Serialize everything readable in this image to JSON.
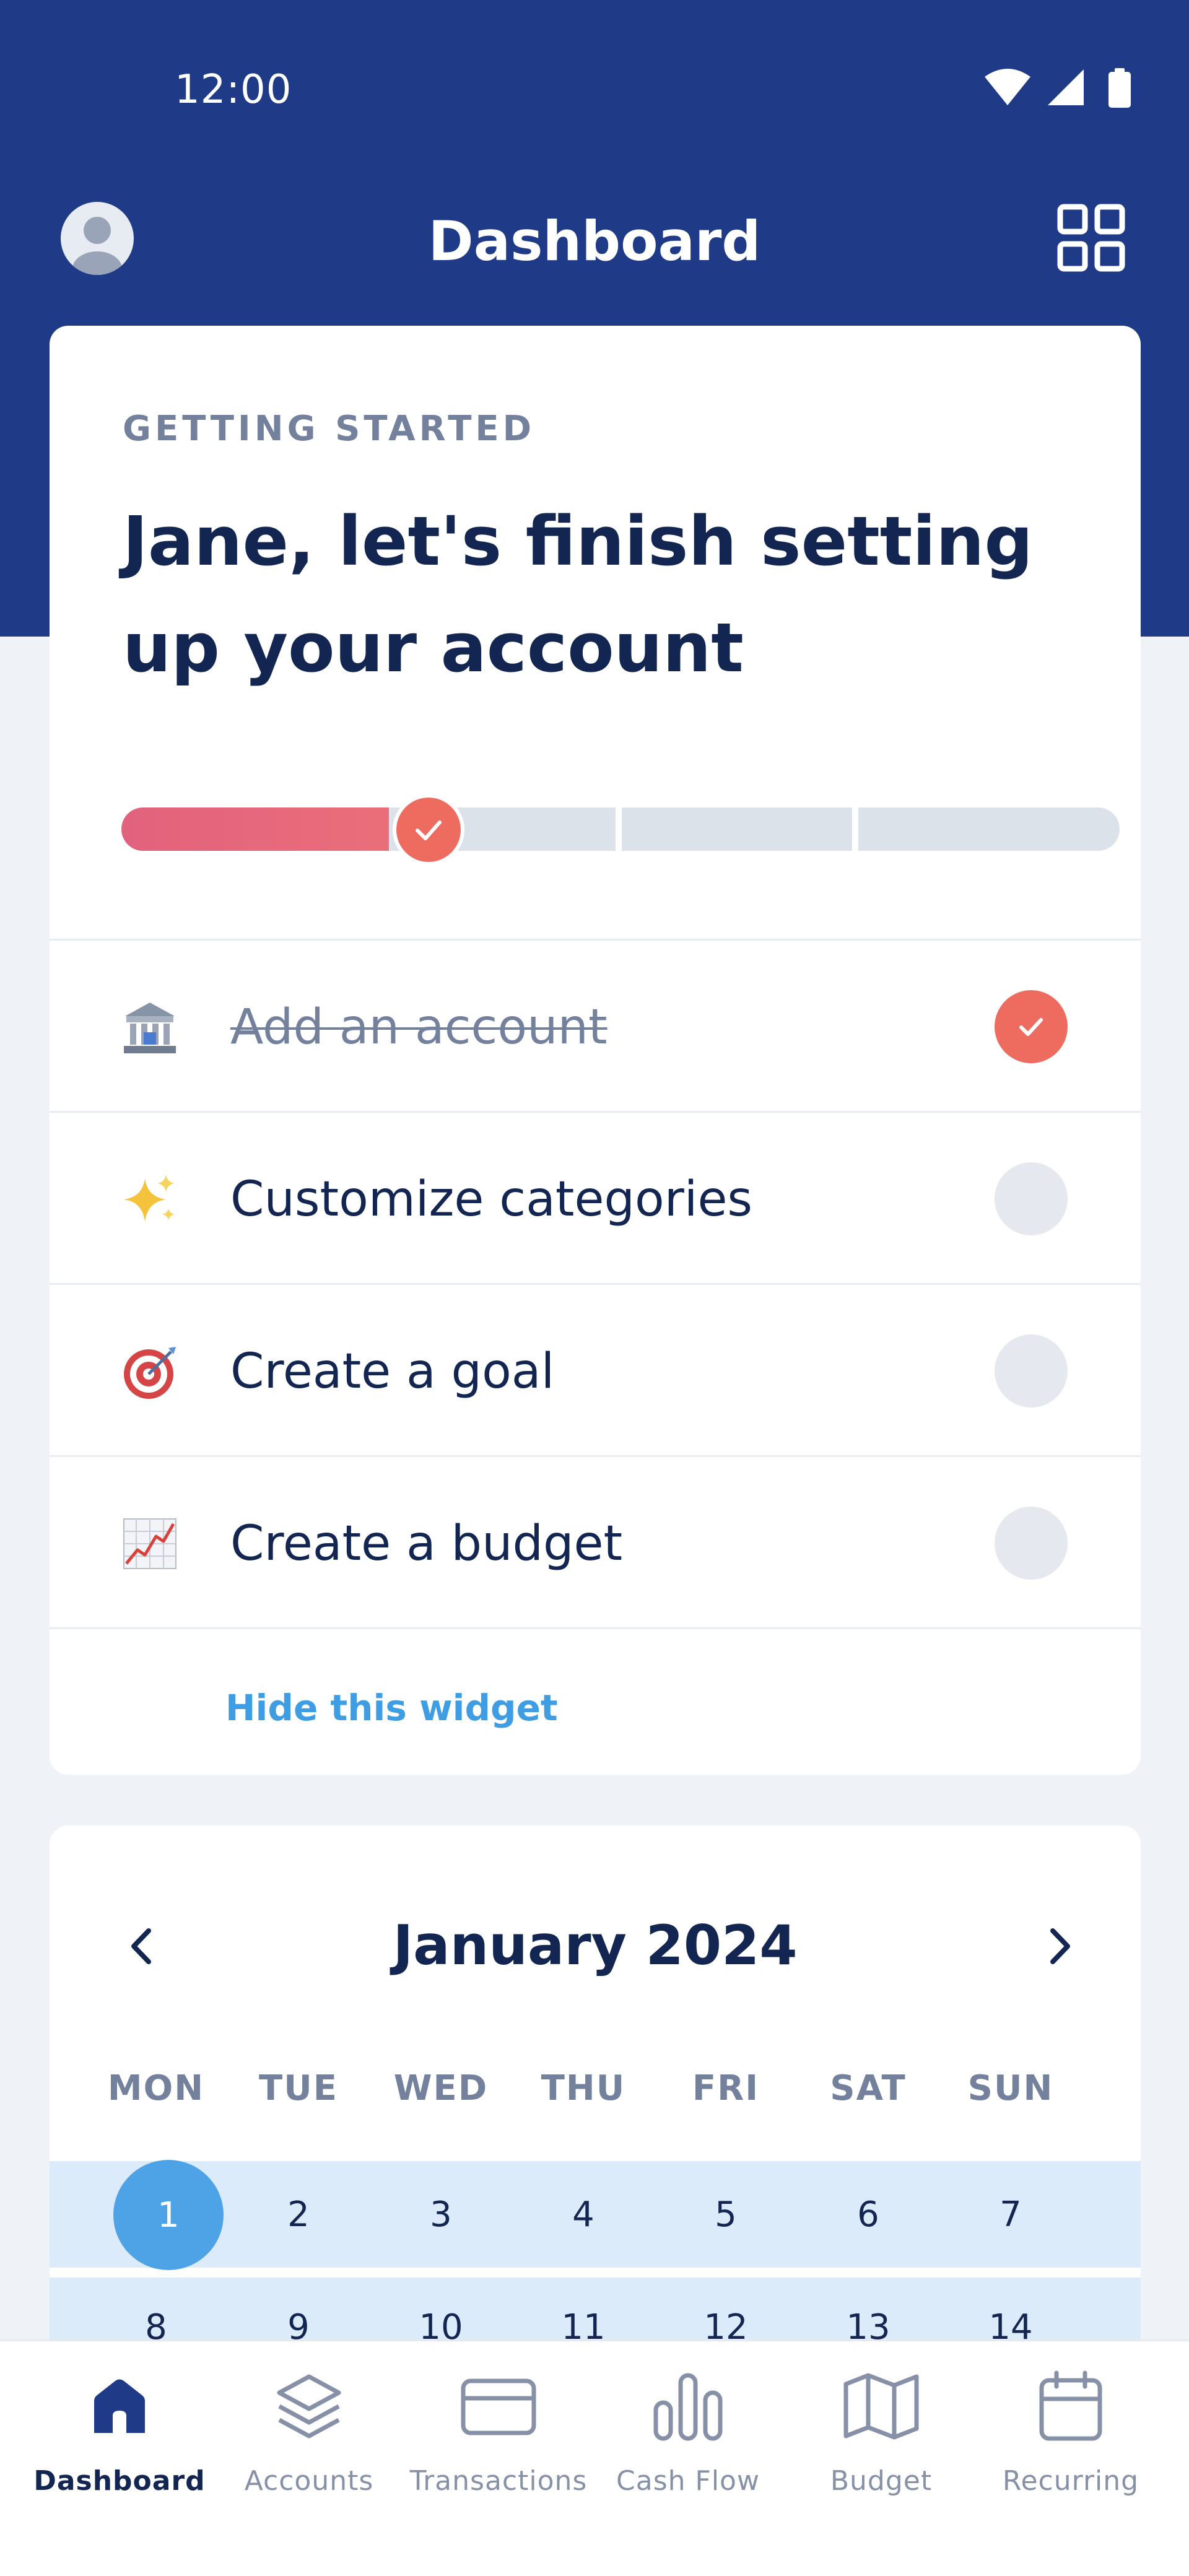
{
  "status_bar": {
    "time": "12:00"
  },
  "app_bar": {
    "title": "Dashboard"
  },
  "getting_started": {
    "eyebrow": "GETTING STARTED",
    "heading": "Jane, let's finish setting up your account",
    "progress": {
      "completed_steps": 1,
      "total_steps": 4
    },
    "tasks": [
      {
        "emoji": "bank-icon",
        "label": "Add an account",
        "done": true
      },
      {
        "emoji": "sparkles-icon",
        "label": "Customize categories",
        "done": false
      },
      {
        "emoji": "target-icon",
        "label": "Create a goal",
        "done": false
      },
      {
        "emoji": "chart-increasing-icon",
        "label": "Create a budget",
        "done": false
      }
    ],
    "hide_link": "Hide this widget"
  },
  "calendar": {
    "month_label": "January 2024",
    "weekdays": [
      "MON",
      "TUE",
      "WED",
      "THU",
      "FRI",
      "SAT",
      "SUN"
    ],
    "weeks": [
      [
        "1",
        "2",
        "3",
        "4",
        "5",
        "6",
        "7"
      ],
      [
        "8",
        "9",
        "10",
        "11",
        "12",
        "13",
        "14"
      ]
    ],
    "selected_day": "1"
  },
  "bottom_nav": [
    {
      "label": "Dashboard",
      "icon": "home-icon",
      "active": true
    },
    {
      "label": "Accounts",
      "icon": "layers-icon",
      "active": false
    },
    {
      "label": "Transactions",
      "icon": "card-icon",
      "active": false
    },
    {
      "label": "Cash Flow",
      "icon": "bar-chart-icon",
      "active": false
    },
    {
      "label": "Budget",
      "icon": "map-icon",
      "active": false
    },
    {
      "label": "Recurring",
      "icon": "calendar-icon",
      "active": false
    }
  ],
  "colors": {
    "header": "#1f3a87",
    "accent": "#ee6c5f",
    "link": "#3f9ee3",
    "calendar_highlight": "#dcebf9",
    "calendar_selected": "#4da3e6"
  }
}
